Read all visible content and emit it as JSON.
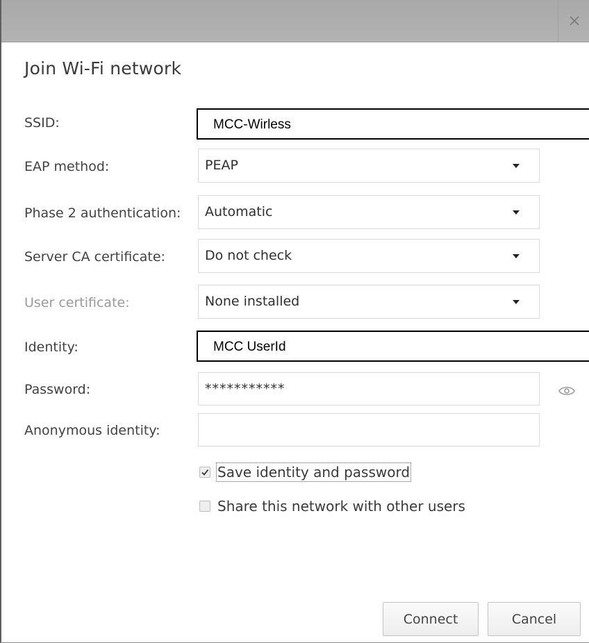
{
  "dialog": {
    "title": "Join Wi-Fi network",
    "close_icon": "close-icon"
  },
  "fields": {
    "ssid": {
      "label": "SSID:",
      "value": "MCC-Wirless"
    },
    "eap_method": {
      "label": "EAP method:",
      "value": "PEAP"
    },
    "phase2_auth": {
      "label": "Phase 2 authentication:",
      "value": "Automatic"
    },
    "server_ca": {
      "label": "Server CA certificate:",
      "value": "Do not check"
    },
    "user_cert": {
      "label": "User certificate:",
      "value": "None installed"
    },
    "identity": {
      "label": "Identity:",
      "value": "MCC UserId"
    },
    "password": {
      "label": "Password:",
      "value": "***********",
      "reveal_icon": "eye-icon"
    },
    "anonymous_identity": {
      "label": "Anonymous identity:",
      "value": ""
    }
  },
  "checkboxes": {
    "save_identity": {
      "label": "Save identity and password",
      "checked": true
    },
    "share_network": {
      "label": "Share this network with other users",
      "checked": false
    }
  },
  "buttons": {
    "connect": "Connect",
    "cancel": "Cancel"
  },
  "colors": {
    "titlebar": "#b0b0b0",
    "label_text": "#424242",
    "disabled_label": "#9a9a9a",
    "field_border": "#dadada"
  }
}
